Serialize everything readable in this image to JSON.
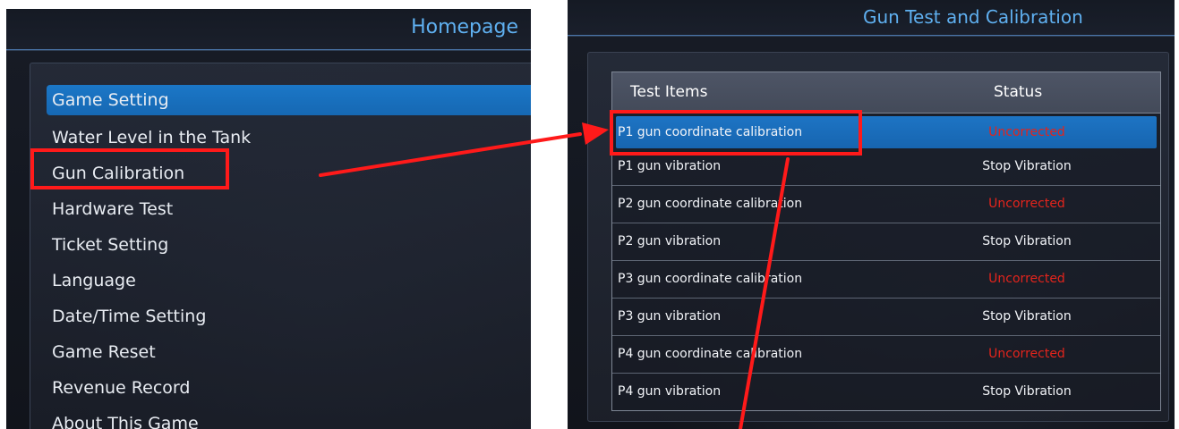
{
  "left_screen": {
    "title": "Homepage",
    "menu_items": [
      {
        "label": "Game Setting",
        "selected": true
      },
      {
        "label": "Water Level in the Tank",
        "selected": false
      },
      {
        "label": "Gun Calibration",
        "selected": false
      },
      {
        "label": "Hardware Test",
        "selected": false
      },
      {
        "label": "Ticket Setting",
        "selected": false
      },
      {
        "label": "Language",
        "selected": false
      },
      {
        "label": "Date/Time Setting",
        "selected": false
      },
      {
        "label": "Game Reset",
        "selected": false
      },
      {
        "label": "Revenue Record",
        "selected": false
      },
      {
        "label": "About This Game",
        "selected": false
      }
    ]
  },
  "right_screen": {
    "title": "Gun Test and Calibration",
    "table": {
      "columns": [
        "Test Items",
        "Status"
      ],
      "rows": [
        {
          "item": "P1 gun coordinate calibration",
          "status": "Uncorrected",
          "selected": true
        },
        {
          "item": "P1 gun vibration",
          "status": "Stop Vibration",
          "selected": false
        },
        {
          "item": "P2 gun coordinate calibration",
          "status": "Uncorrected",
          "selected": false
        },
        {
          "item": "P2 gun vibration",
          "status": "Stop Vibration",
          "selected": false
        },
        {
          "item": "P3 gun coordinate calibration",
          "status": "Uncorrected",
          "selected": false
        },
        {
          "item": "P3 gun vibration",
          "status": "Stop Vibration",
          "selected": false
        },
        {
          "item": "P4 gun coordinate calibration",
          "status": "Uncorrected",
          "selected": false
        },
        {
          "item": "P4 gun vibration",
          "status": "Stop Vibration",
          "selected": false
        }
      ]
    }
  },
  "colors": {
    "title_blue": "#5fb0f0",
    "selection_blue": "#1b77c7",
    "status_uncorrected": "#e3241c",
    "annotation_red": "#ff1a1a"
  }
}
